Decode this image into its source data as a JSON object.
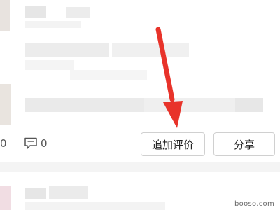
{
  "post": {
    "like_count": "0",
    "comment_count": "0"
  },
  "actions": {
    "add_review_label": "追加评价",
    "share_label": "分享"
  },
  "icons": {
    "comment": "comment-icon",
    "annotation": "red-arrow-icon"
  },
  "colors": {
    "arrow": "#e8332a",
    "border": "#d0d0d0"
  },
  "watermark": "booso.com"
}
